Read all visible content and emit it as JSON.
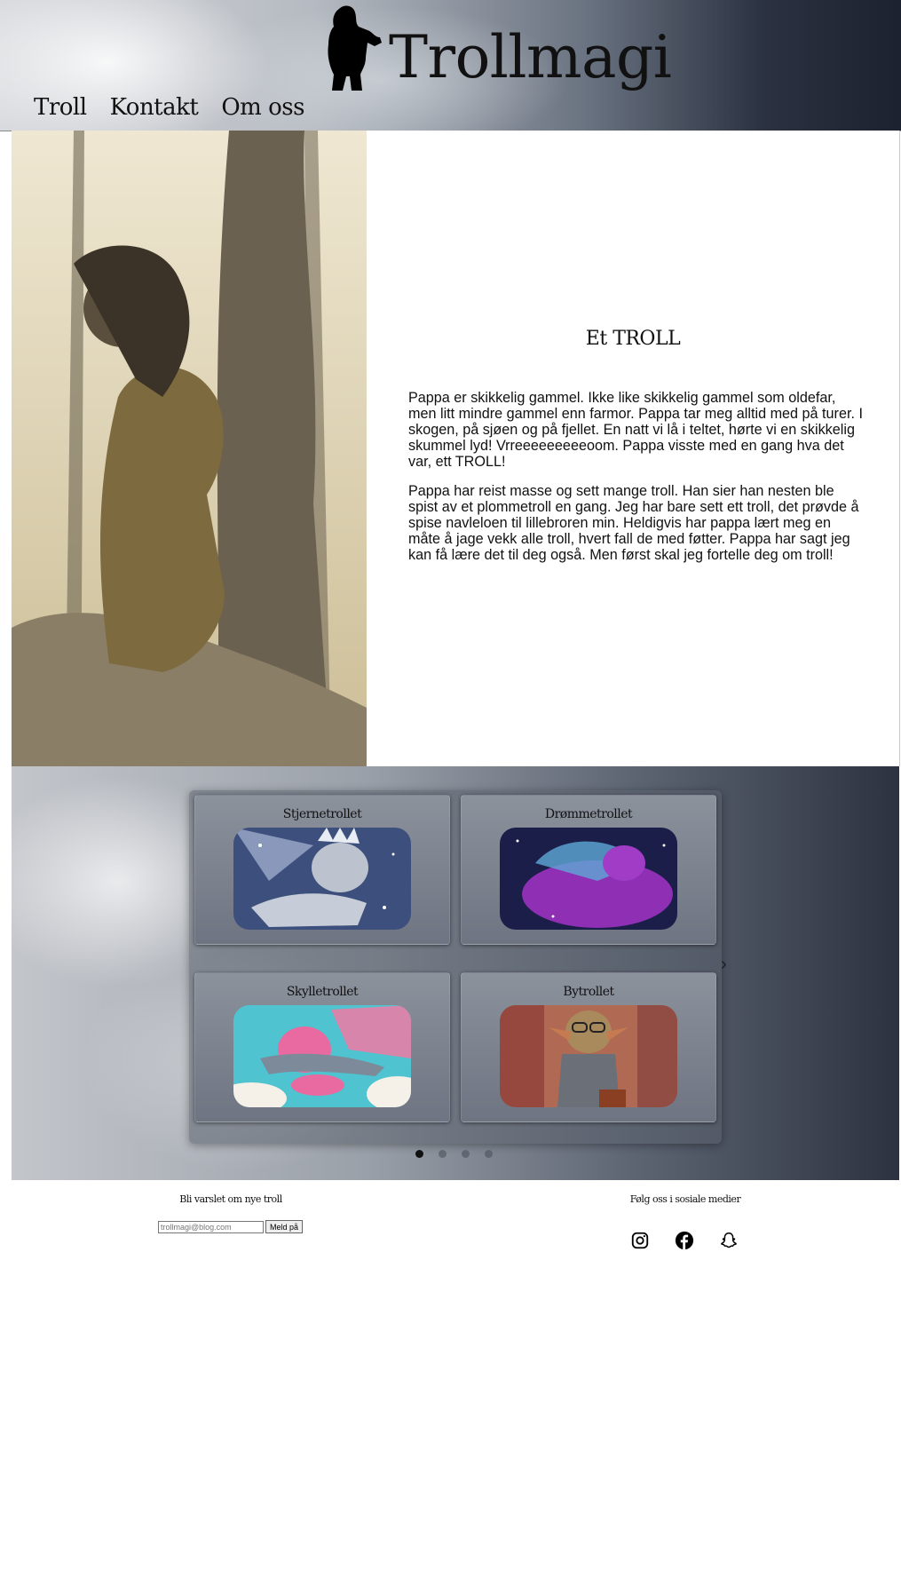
{
  "header": {
    "title": "Trollmagi",
    "nav": [
      "Troll",
      "Kontakt",
      "Om oss"
    ]
  },
  "hero": {
    "heading": "Et TROLL",
    "paragraphs": [
      "Pappa er skikkelig gammel. Ikke like skikkelig gammel som oldefar, men litt mindre gammel enn farmor. Pappa tar meg alltid med på turer. I skogen, på sjøen og på fjellet. En natt vi lå i teltet, hørte vi en skikkelig skummel lyd! Vrreeeeeeeeeoom. Pappa visste med en gang hva det var, ett TROLL!",
      "Pappa har reist masse og sett mange troll. Han sier han nesten ble spist av et plommetroll en gang. Jeg har bare sett ett troll, det prøvde å spise navleloen til lillebroren min. Heldigvis har pappa lært meg en måte å jage vekk alle troll, hvert fall de med føtter. Pappa har sagt jeg kan få lære det til deg også. Men først skal jeg fortelle deg om troll!"
    ]
  },
  "gallery": {
    "cards": [
      {
        "title": "Stjernetrollet"
      },
      {
        "title": "Drømmetrollet"
      },
      {
        "title": "Skylletrollet"
      },
      {
        "title": "Bytrollet"
      }
    ],
    "next_icon": "chevron-right-icon",
    "dot_count": 4,
    "active_dot": 0
  },
  "footer": {
    "newsletter_title": "Bli varslet om nye troll",
    "email_placeholder": "trollmagi@blog.com",
    "submit_label": "Meld på",
    "social_title": "Følg oss i sosiale medier",
    "social_icons": [
      "instagram-icon",
      "facebook-icon",
      "snapchat-icon"
    ]
  }
}
